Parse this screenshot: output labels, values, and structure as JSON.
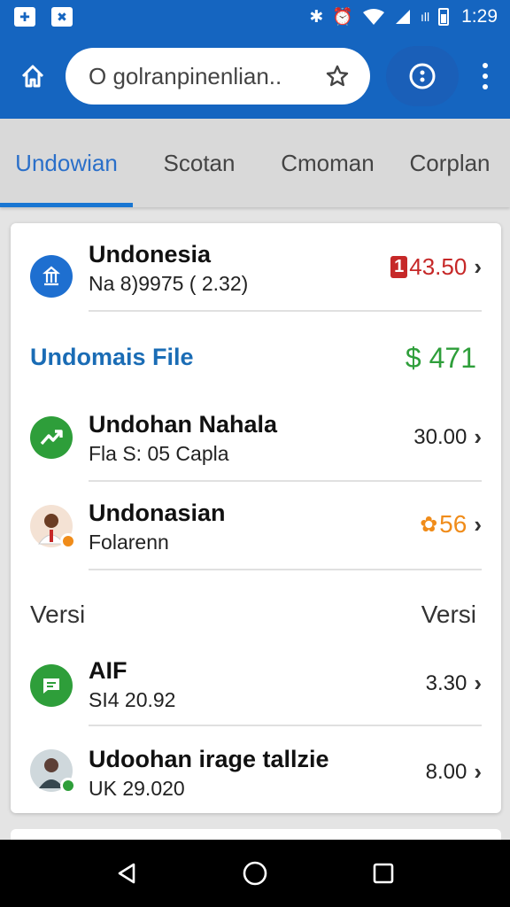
{
  "status_bar": {
    "time": "1:29",
    "signal_text": "ıll"
  },
  "search": {
    "text": "O golranpinenlian.."
  },
  "tabs": [
    {
      "label": "Undowian",
      "active": true
    },
    {
      "label": "Scotan",
      "active": false
    },
    {
      "label": "Cmoman",
      "active": false
    },
    {
      "label": "Corplan",
      "active": false
    }
  ],
  "rows": [
    {
      "title": "Undonesia",
      "subtitle": "Na 8)9975 ( 2.32)",
      "value": "43.50",
      "badge": "1",
      "icon": "landmark-icon"
    },
    {
      "title": "Undohan Nahala",
      "subtitle": "Fla S: 05 Capla",
      "value": "30.00",
      "icon": "trend-up-icon"
    },
    {
      "title": "Undonasian",
      "subtitle": "Folarenn",
      "value": "56",
      "icon": "avatar-icon"
    },
    {
      "title": "AIF",
      "subtitle": "SI4 20.92",
      "value": "3.30",
      "icon": "chat-icon"
    },
    {
      "title": "Udoohan irage tallzie",
      "subtitle": "UK 29.020",
      "value": "8.00",
      "icon": "avatar-icon"
    }
  ],
  "section1": {
    "label": "Undomais File",
    "value": "$ 471"
  },
  "section2": {
    "left": "Versi",
    "right": "Versi"
  },
  "colors": {
    "accent": "#1565c0",
    "green": "#2e9e3a",
    "red": "#c62828",
    "orange": "#f08c1a"
  }
}
